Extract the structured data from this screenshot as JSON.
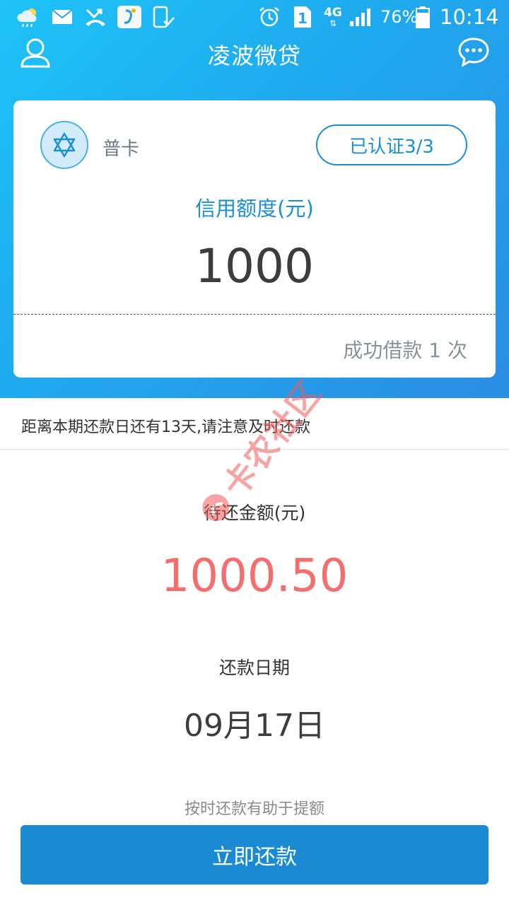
{
  "status_bar": {
    "battery": "76%",
    "time": "10:14",
    "network": "4G",
    "sim_slot": "1"
  },
  "app_bar": {
    "title": "凌波微贷"
  },
  "credit_card": {
    "level": "普卡",
    "verify_button": "已认证3/3",
    "limit_title": "信用额度(元)",
    "limit_value": "1000",
    "success_count": "成功借款 1 次"
  },
  "notice": "距离本期还款日还有13天,请注意及时还款",
  "repayment": {
    "due_label": "待还金额(元)",
    "due_amount": "1000.50",
    "date_label": "还款日期",
    "date_value": "09月17日",
    "hint": "按时还款有助于提额",
    "pay_button": "立即还款"
  },
  "watermark": {
    "text": "卡农社区"
  },
  "colors": {
    "primary": "#1a8fd6",
    "header_gradient_start": "#1ec3f7",
    "header_gradient_end": "#2b8de3",
    "amount_red": "#f46e6e",
    "watermark_red": "#f05a5a"
  },
  "icons": {
    "status_left": [
      "weather-cloud-icon",
      "mail-icon",
      "missed-call-icon",
      "app-notification-icon",
      "phone-check-icon"
    ],
    "status_right": [
      "alarm-icon",
      "sim-icon",
      "network-4g-icon",
      "signal-icon",
      "battery-icon"
    ],
    "app_bar_left": "user-profile-icon",
    "app_bar_right": "message-icon",
    "badge": "star-badge-icon"
  }
}
